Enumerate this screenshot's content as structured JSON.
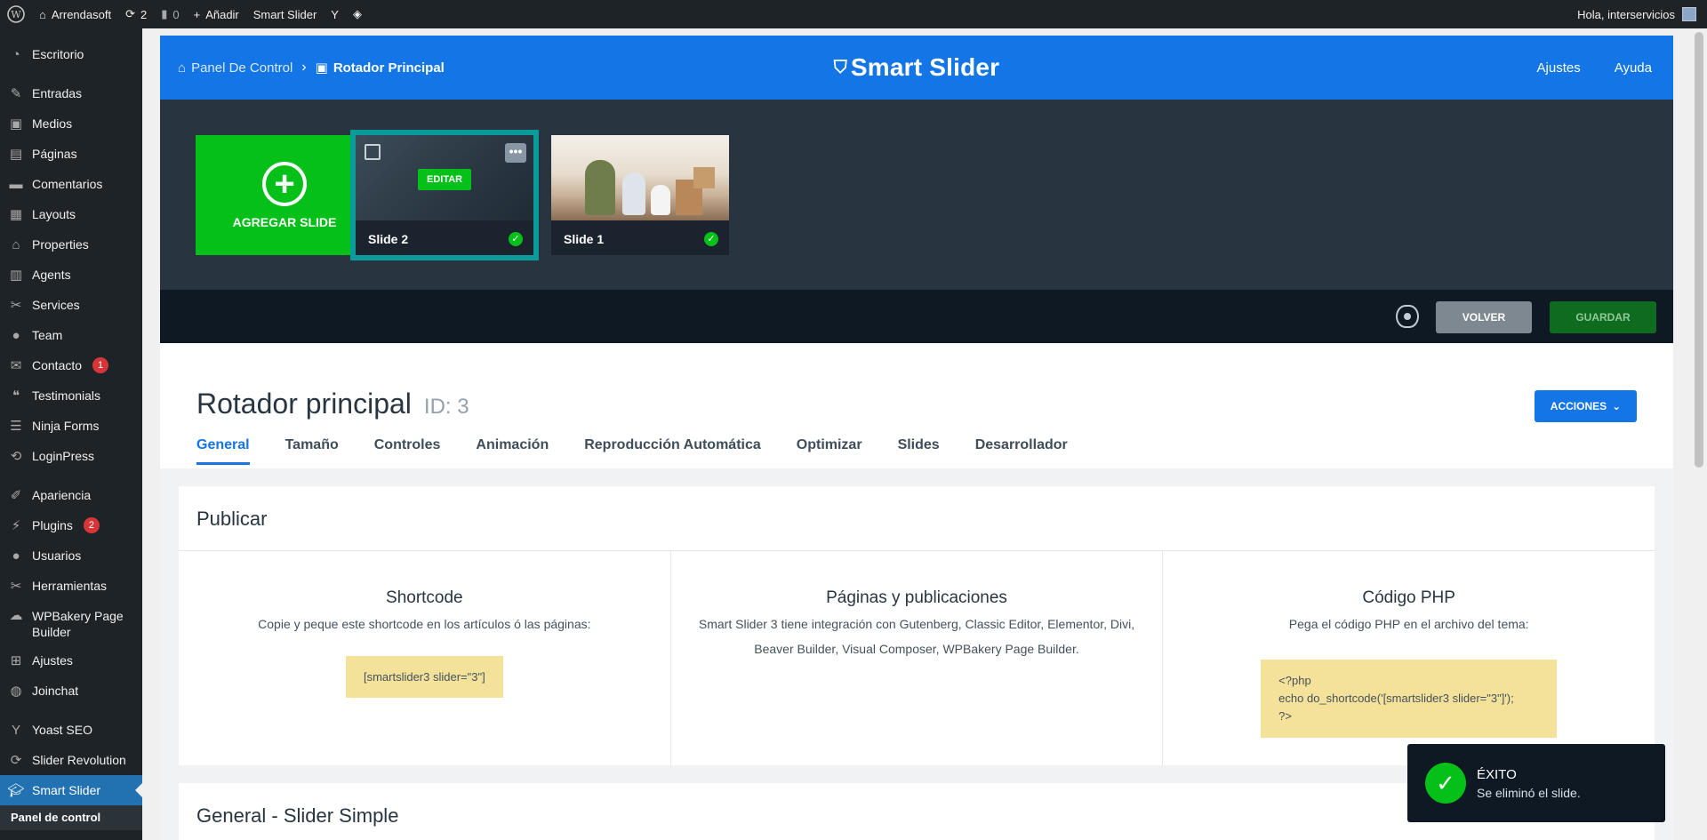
{
  "adminbar": {
    "site": "Arrendasoft",
    "updates": "2",
    "comments": "0",
    "add_new": "Añadir",
    "smart_slider": "Smart Slider",
    "greeting": "Hola, interservicios"
  },
  "sidebar": {
    "items": [
      {
        "label": "Escritorio",
        "icon": "gauge-icon"
      },
      {
        "label": "Entradas",
        "icon": "pin-icon"
      },
      {
        "label": "Medios",
        "icon": "media-icon"
      },
      {
        "label": "Páginas",
        "icon": "page-icon"
      },
      {
        "label": "Comentarios",
        "icon": "comment-icon"
      },
      {
        "label": "Layouts",
        "icon": "layout-icon"
      },
      {
        "label": "Properties",
        "icon": "house-icon"
      },
      {
        "label": "Agents",
        "icon": "agents-icon"
      },
      {
        "label": "Services",
        "icon": "wrench-icon"
      },
      {
        "label": "Team",
        "icon": "user-icon"
      },
      {
        "label": "Contacto",
        "icon": "mail-icon",
        "badge": "1"
      },
      {
        "label": "Testimonials",
        "icon": "quote-icon"
      },
      {
        "label": "Ninja Forms",
        "icon": "form-icon"
      },
      {
        "label": "LoginPress",
        "icon": "login-icon"
      },
      {
        "label": "Apariencia",
        "icon": "brush-icon"
      },
      {
        "label": "Plugins",
        "icon": "plug-icon",
        "badge": "2"
      },
      {
        "label": "Usuarios",
        "icon": "user-icon"
      },
      {
        "label": "Herramientas",
        "icon": "tool-icon"
      },
      {
        "label": "WPBakery Page Builder",
        "icon": "cloud-icon"
      },
      {
        "label": "Ajustes",
        "icon": "settings-icon"
      },
      {
        "label": "Joinchat",
        "icon": "chat-icon"
      },
      {
        "label": "Yoast SEO",
        "icon": "yoast-icon"
      },
      {
        "label": "Slider Revolution",
        "icon": "refresh-icon"
      },
      {
        "label": "Smart Slider",
        "icon": "graduation-cap-icon"
      }
    ],
    "submenu_current": "Panel de control"
  },
  "header": {
    "crumb_home": "Panel De Control",
    "crumb_current": "Rotador Principal",
    "logo": "Smart Slider",
    "settings": "Ajustes",
    "help": "Ayuda"
  },
  "slides": {
    "add_label": "AGREGAR SLIDE",
    "edit_label": "EDITAR",
    "dots": "•••",
    "slide2_name": "Slide 2",
    "slide1_name": "Slide 1"
  },
  "toolbar": {
    "back": "VOLVER",
    "save": "GUARDAR"
  },
  "content": {
    "title": "Rotador principal",
    "id_label": "ID: 3",
    "actions": "ACCIONES",
    "tabs": [
      "General",
      "Tamaño",
      "Controles",
      "Animación",
      "Reproducción Automática",
      "Optimizar",
      "Slides",
      "Desarrollador"
    ]
  },
  "publish": {
    "title": "Publicar",
    "shortcode_title": "Shortcode",
    "shortcode_desc": "Copie y peque este shortcode en los artículos ó las páginas:",
    "shortcode_code": "[smartslider3 slider=\"3\"]",
    "pages_title": "Páginas y publicaciones",
    "pages_desc": "Smart Slider 3 tiene integración con Gutenberg, Classic Editor, Elementor, Divi, Beaver Builder, Visual Composer, WPBakery Page Builder.",
    "php_title": "Código PHP",
    "php_desc": "Pega el código PHP en el archivo del tema:",
    "php_line1": "<?php",
    "php_line2": "echo do_shortcode('[smartslider3 slider=\"3\"]');",
    "php_line3": "?>"
  },
  "general_section": {
    "title": "General - Slider Simple"
  },
  "toast": {
    "heading": "ÉXITO",
    "message": "Se eliminó el slide."
  }
}
